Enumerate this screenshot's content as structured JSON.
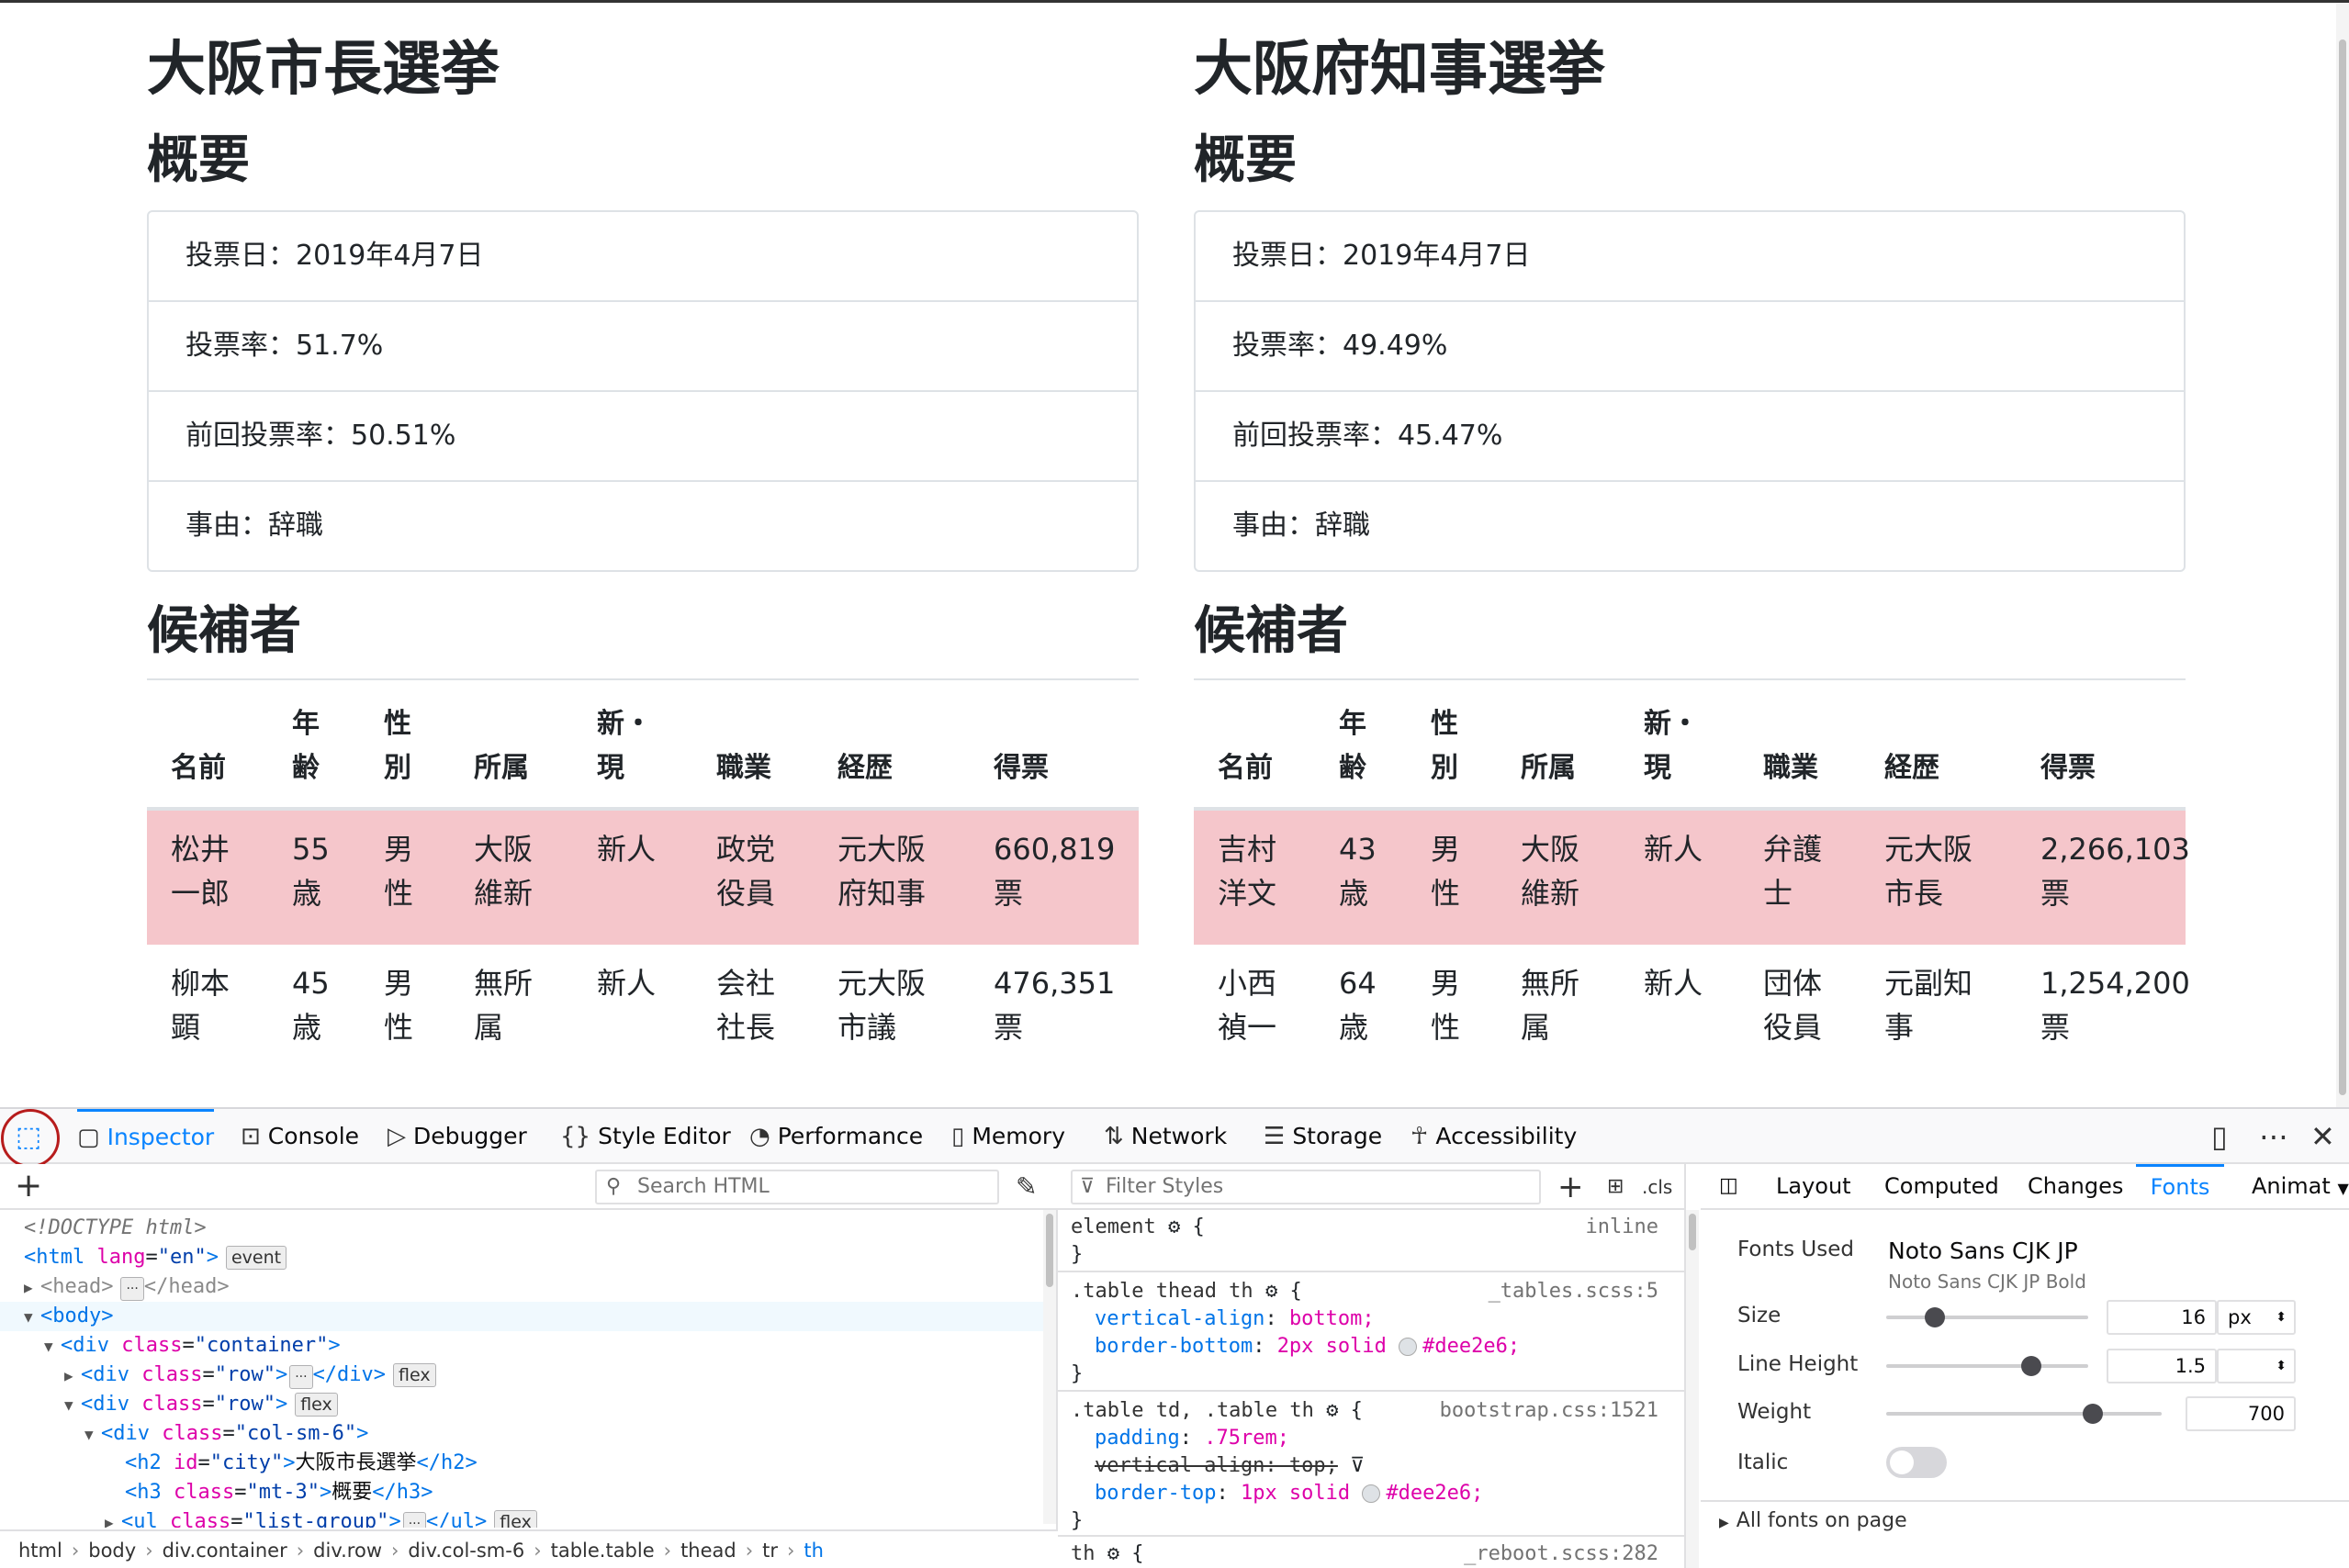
{
  "columns": [
    {
      "title": "大阪市長選挙",
      "summary_heading": "概要",
      "summary": [
        "投票日：2019年4月7日",
        "投票率：51.7%",
        "前回投票率：50.51%",
        "事由：辞職"
      ],
      "candidates_heading": "候補者",
      "headers": [
        [
          "",
          "名前"
        ],
        [
          "年",
          "齢"
        ],
        [
          "性",
          "別"
        ],
        [
          "",
          "所属"
        ],
        [
          "新・",
          "現"
        ],
        [
          "",
          "職業"
        ],
        [
          "",
          "経歴"
        ],
        [
          "",
          "得票"
        ]
      ],
      "rows": [
        {
          "winner": true,
          "cells": [
            [
              "松井",
              "一郎"
            ],
            [
              "55",
              "歳"
            ],
            [
              "男",
              "性"
            ],
            [
              "大阪",
              "維新"
            ],
            [
              "新人",
              ""
            ],
            [
              "政党",
              "役員"
            ],
            [
              "元大阪",
              "府知事"
            ],
            [
              "660,819",
              "票"
            ]
          ]
        },
        {
          "winner": false,
          "cells": [
            [
              "柳本",
              "顕"
            ],
            [
              "45",
              "歳"
            ],
            [
              "男",
              "性"
            ],
            [
              "無所",
              "属"
            ],
            [
              "新人",
              ""
            ],
            [
              "会社",
              "社長"
            ],
            [
              "元大阪",
              "市議"
            ],
            [
              "476,351",
              "票"
            ]
          ]
        }
      ]
    },
    {
      "title": "大阪府知事選挙",
      "summary_heading": "概要",
      "summary": [
        "投票日：2019年4月7日",
        "投票率：49.49%",
        "前回投票率：45.47%",
        "事由：辞職"
      ],
      "candidates_heading": "候補者",
      "headers": [
        [
          "",
          "名前"
        ],
        [
          "年",
          "齢"
        ],
        [
          "性",
          "別"
        ],
        [
          "",
          "所属"
        ],
        [
          "新・",
          "現"
        ],
        [
          "",
          "職業"
        ],
        [
          "",
          "経歴"
        ],
        [
          "",
          "得票"
        ]
      ],
      "rows": [
        {
          "winner": true,
          "cells": [
            [
              "吉村",
              "洋文"
            ],
            [
              "43",
              "歳"
            ],
            [
              "男",
              "性"
            ],
            [
              "大阪",
              "維新"
            ],
            [
              "新人",
              ""
            ],
            [
              "弁護",
              "士"
            ],
            [
              "元大阪",
              "市長"
            ],
            [
              "2,266,103",
              "票"
            ]
          ]
        },
        {
          "winner": false,
          "cells": [
            [
              "小西",
              "禎一"
            ],
            [
              "64",
              "歳"
            ],
            [
              "男",
              "性"
            ],
            [
              "無所",
              "属"
            ],
            [
              "新人",
              ""
            ],
            [
              "団体",
              "役員"
            ],
            [
              "元副知",
              "事"
            ],
            [
              "1,254,200",
              "票"
            ]
          ]
        }
      ]
    }
  ],
  "devtools": {
    "tabs": [
      {
        "label": "Inspector",
        "icon": "inspector-icon"
      },
      {
        "label": "Console",
        "icon": "console-icon"
      },
      {
        "label": "Debugger",
        "icon": "debugger-icon"
      },
      {
        "label": "Style Editor",
        "icon": "style-editor-icon"
      },
      {
        "label": "Performance",
        "icon": "performance-icon"
      },
      {
        "label": "Memory",
        "icon": "memory-icon"
      },
      {
        "label": "Network",
        "icon": "network-icon"
      },
      {
        "label": "Storage",
        "icon": "storage-icon"
      },
      {
        "label": "Accessibility",
        "icon": "accessibility-icon"
      }
    ],
    "active_tab": "Inspector",
    "search_html_placeholder": "Search HTML",
    "filter_styles_placeholder": "Filter Styles",
    "cls_label": ".cls",
    "markup": {
      "doctype": "<!DOCTYPE html>",
      "html_open": "<html",
      "lang_attr": "lang",
      "lang_val": "\"en\"",
      "gt": ">",
      "event_badge": "event",
      "head": "<head>",
      "head_close": "</head>",
      "body": "<body>",
      "div": "<div",
      "class_attr": "class",
      "container_val": "\"container\"",
      "row_val": "\"row\"",
      "div_close": "</div>",
      "flex_badge": "flex",
      "colsm6_val": "\"col-sm-6\"",
      "h2_open": "<h2",
      "id_attr": "id",
      "city_val": "\"city\"",
      "h2_text": "大阪市長選挙",
      "h2_close": "</h2>",
      "h3_open": "<h3",
      "mt3_val": "\"mt-3\"",
      "h3_text": "概要",
      "h3_close": "</h3>",
      "ul_open": "<ul",
      "listgroup_val": "\"list-group\"",
      "ul_close": "</ul>",
      "ellipsis": "···"
    },
    "breadcrumbs": [
      "html",
      "body",
      "div.container",
      "div.row",
      "div.col-sm-6",
      "table.table",
      "thead",
      "tr",
      "th"
    ],
    "rules": {
      "element_sel": "element",
      "element_src": "inline",
      "r1_sel": ".table thead th",
      "r1_src": "_tables.scss:5",
      "r1_p1": "vertical-align",
      "r1_v1": "bottom;",
      "r1_p2": "border-bottom",
      "r1_v2a": "2px solid",
      "r1_v2b": "#dee2e6;",
      "r2_sel": ".table td, .table th",
      "r2_src": "bootstrap.css:1521",
      "r2_p1": "padding",
      "r2_v1": ".75rem;",
      "r2_p2": "vertical-align: top;",
      "r2_p3": "border-top",
      "r2_v3a": "1px solid",
      "r2_v3b": "#dee2e6;",
      "r3_sel": "th",
      "r3_src": "_reboot.scss:282",
      "open_brace": "{",
      "close_brace": "}",
      "colon": ":"
    },
    "right_tabs": [
      "Layout",
      "Computed",
      "Changes",
      "Fonts",
      "Animat"
    ],
    "active_right_tab": "Fonts",
    "fonts": {
      "fonts_used_label": "Fonts Used",
      "font_name": "Noto Sans CJK JP",
      "font_sub": "Noto Sans CJK JP Bold",
      "size_label": "Size",
      "size_value": "16",
      "size_unit": "px",
      "size_level": 0.24,
      "line_height_label": "Line Height",
      "line_height_value": "1.5",
      "line_height_level": 0.72,
      "weight_label": "Weight",
      "weight_value": "700",
      "weight_level": 0.75,
      "italic_label": "Italic",
      "all_fonts_label": "All fonts on page"
    }
  }
}
